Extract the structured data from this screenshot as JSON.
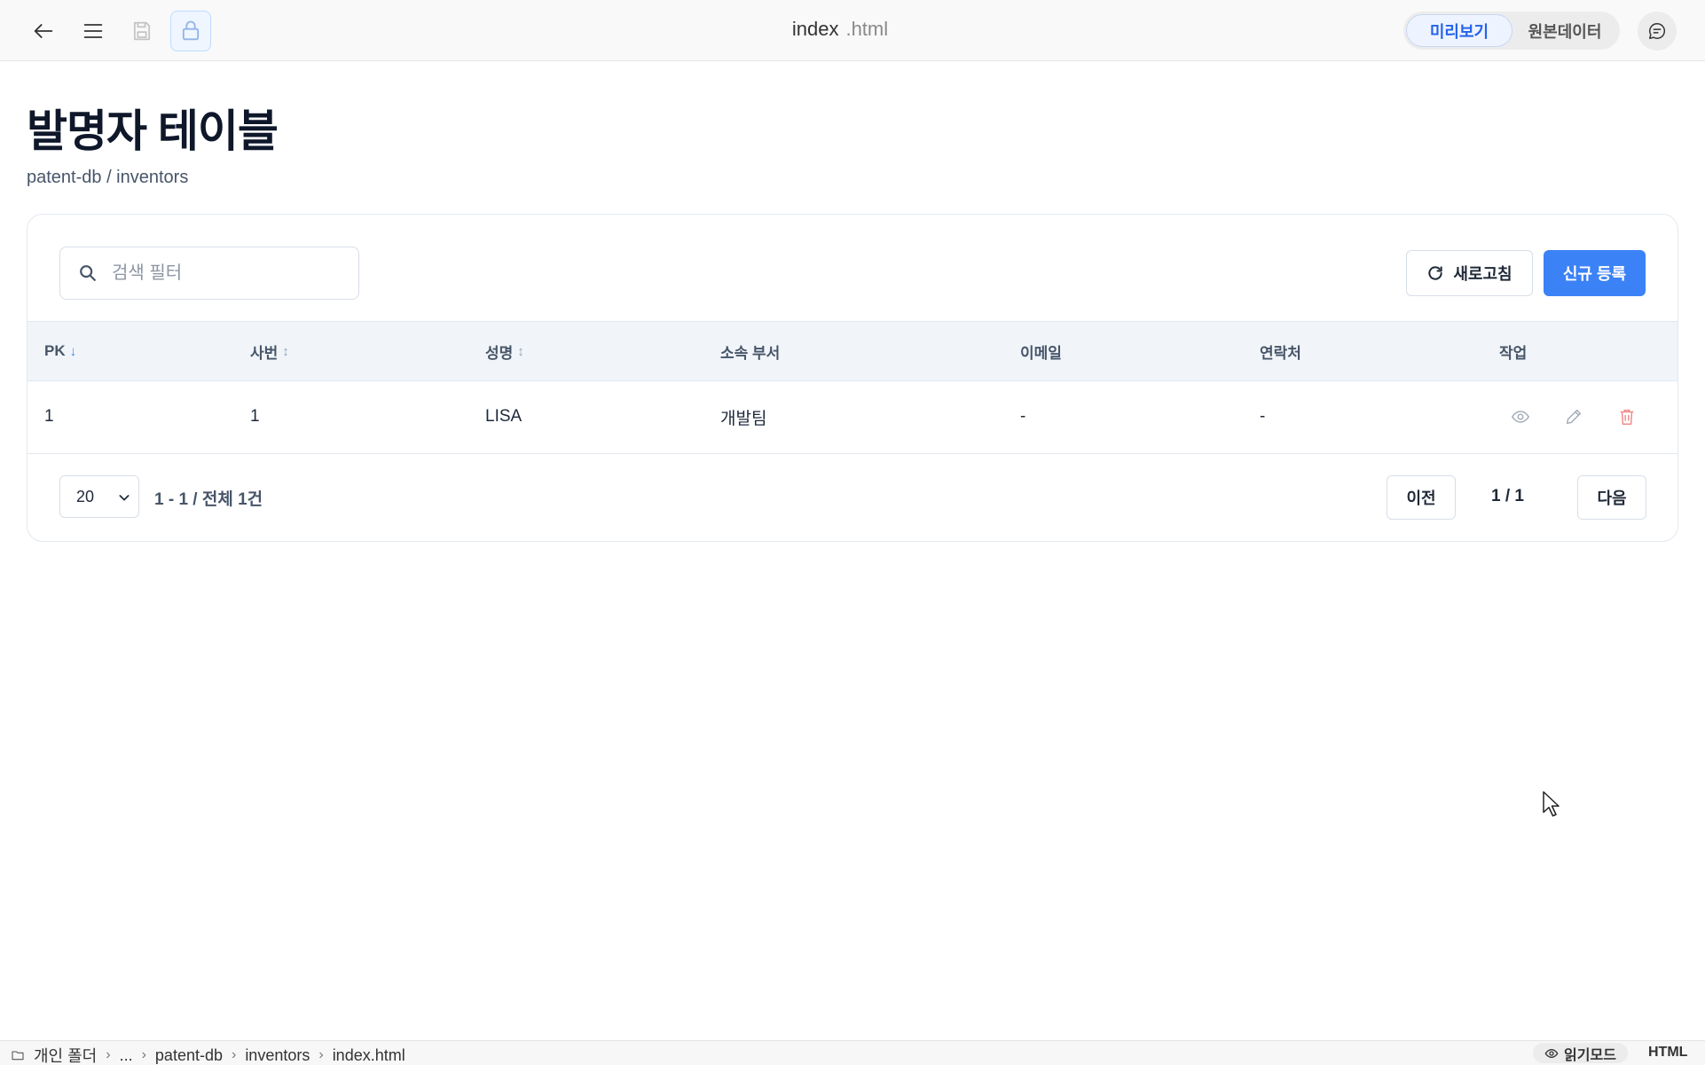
{
  "topbar": {
    "file_name": "index",
    "file_ext": ".html",
    "view_modes": [
      "미리보기",
      "원본데이터"
    ],
    "active_view": "미리보기"
  },
  "page": {
    "title": "발명자 테이블",
    "path": "patent-db / inventors"
  },
  "toolbar": {
    "search_placeholder": "검색 필터",
    "refresh_label": "새로고침",
    "new_label": "신규 등록"
  },
  "table": {
    "columns": [
      "PK",
      "사번",
      "성명",
      "소속 부서",
      "이메일",
      "연락처",
      "작업"
    ],
    "rows": [
      [
        "1",
        "1",
        "LISA",
        "개발팀",
        "-",
        "-"
      ]
    ]
  },
  "pagination": {
    "page_size": "20",
    "range_info": "1 - 1 / 전체 1건",
    "prev_label": "이전",
    "page_indicator": "1 / 1",
    "next_label": "다음"
  },
  "statusbar": {
    "path": [
      "개인 폴더",
      "...",
      "patent-db",
      "inventors",
      "index.html"
    ],
    "read_mode_label": "읽기모드",
    "language": "HTML"
  },
  "colors": {
    "accent": "#3b82f6",
    "delete": "#ef4444"
  }
}
